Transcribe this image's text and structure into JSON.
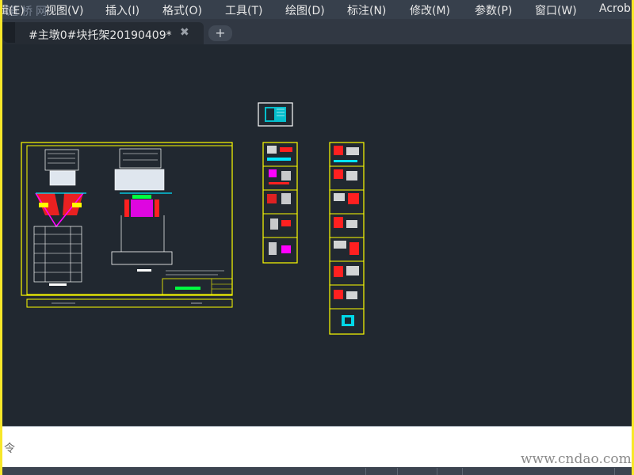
{
  "menu": {
    "items": [
      {
        "label": "辑(E)"
      },
      {
        "label": "视图(V)"
      },
      {
        "label": "插入(I)"
      },
      {
        "label": "格式(O)"
      },
      {
        "label": "工具(T)"
      },
      {
        "label": "绘图(D)"
      },
      {
        "label": "标注(N)"
      },
      {
        "label": "修改(M)"
      },
      {
        "label": "参数(P)"
      },
      {
        "label": "窗口(W)"
      },
      {
        "label": "Acrob"
      }
    ],
    "watermark": "道桥网"
  },
  "tabs": {
    "active_label": "#主墩0#块托架20190409*",
    "close_glyph": "✖",
    "add_glyph": "+"
  },
  "command": {
    "text": "令"
  },
  "watermark_bottom": "www.cndao.com",
  "colors": {
    "frame": "#f7e72a",
    "background": "#212830",
    "drawing_border": "#ffff00",
    "drawing_line": "#ffffff",
    "accent_magenta": "#ff00ff",
    "accent_red": "#ff2020",
    "accent_cyan": "#00e5ff",
    "accent_green": "#00ff40"
  }
}
